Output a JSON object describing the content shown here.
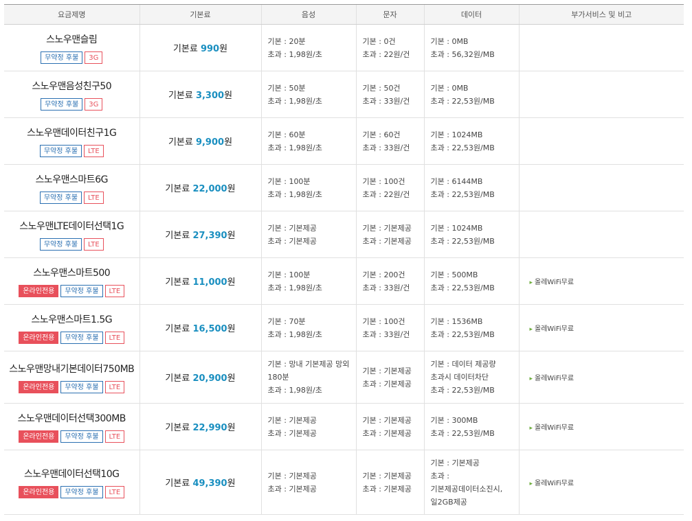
{
  "headers": [
    "요금제명",
    "기본료",
    "음성",
    "문자",
    "데이터",
    "부가서비스 및 비고"
  ],
  "fee_prefix": "기본료 ",
  "fee_suffix": "원",
  "badge_labels": {
    "contract": "무약정 후불",
    "online": "온라인전용"
  },
  "plans": [
    {
      "name": "스노우맨슬림",
      "badges": [
        "contract",
        "3G"
      ],
      "fee": "990",
      "voice": [
        "기본 : 20분",
        "초과 : 1,98원/초"
      ],
      "sms": [
        "기본 : 0건",
        "초과 : 22원/건"
      ],
      "data": [
        "기본 : 0MB",
        "초과 : 56,32원/MB"
      ],
      "extra": ""
    },
    {
      "name": "스노우맨음성친구50",
      "badges": [
        "contract",
        "3G"
      ],
      "fee": "3,300",
      "voice": [
        "기본 : 50분",
        "초과 : 1,98원/초"
      ],
      "sms": [
        "기본 : 50건",
        "초과 : 33원/건"
      ],
      "data": [
        "기본 : 0MB",
        "초과 : 22,53원/MB"
      ],
      "extra": ""
    },
    {
      "name": "스노우맨데이터친구1G",
      "badges": [
        "contract",
        "LTE"
      ],
      "fee": "9,900",
      "voice": [
        "기본 : 60분",
        "초과 : 1,98원/초"
      ],
      "sms": [
        "기본 : 60건",
        "초과 : 33원/건"
      ],
      "data": [
        "기본 : 1024MB",
        "초과 : 22,53원/MB"
      ],
      "extra": ""
    },
    {
      "name": "스노우맨스마트6G",
      "badges": [
        "contract",
        "LTE"
      ],
      "fee": "22,000",
      "voice": [
        "기본 : 100분",
        "초과 : 1,98원/초"
      ],
      "sms": [
        "기본 : 100건",
        "초과 : 22원/건"
      ],
      "data": [
        "기본 : 6144MB",
        "초과 : 22,53원/MB"
      ],
      "extra": ""
    },
    {
      "name": "스노우맨LTE데이터선택1G",
      "badges": [
        "contract",
        "LTE"
      ],
      "fee": "27,390",
      "voice": [
        "기본 : 기본제공",
        "초과 : 기본제공"
      ],
      "sms": [
        "기본 : 기본제공",
        "초과 : 기본제공"
      ],
      "data": [
        "기본 : 1024MB",
        "초과 : 22,53원/MB"
      ],
      "extra": ""
    },
    {
      "name": "스노우맨스마트500",
      "badges": [
        "online",
        "contract",
        "LTE"
      ],
      "fee": "11,000",
      "voice": [
        "기본 : 100분",
        "초과 : 1,98원/초"
      ],
      "sms": [
        "기본 : 200건",
        "초과 : 33원/건"
      ],
      "data": [
        "기본 : 500MB",
        "초과 : 22,53원/MB"
      ],
      "extra": "올레WiFi무료"
    },
    {
      "name": "스노우맨스마트1.5G",
      "badges": [
        "online",
        "contract",
        "LTE"
      ],
      "fee": "16,500",
      "voice": [
        "기본 : 70분",
        "초과 : 1,98원/초"
      ],
      "sms": [
        "기본 : 100건",
        "초과 : 33원/건"
      ],
      "data": [
        "기본 : 1536MB",
        "초과 : 22,53원/MB"
      ],
      "extra": "올레WiFi무료"
    },
    {
      "name": "스노우맨망내기본데이터750MB",
      "badges": [
        "online",
        "contract",
        "LTE"
      ],
      "fee": "20,900",
      "voice": [
        "기본 : 망내 기본제공 망외",
        "180분",
        "초과 : 1,98원/초"
      ],
      "sms": [
        "기본 : 기본제공",
        "초과 : 기본제공"
      ],
      "data": [
        "기본 : 데이터 제공량",
        "초과시 데이터차단",
        "초과 : 22,53원/MB"
      ],
      "extra": "올레WiFi무료"
    },
    {
      "name": "스노우맨데이터선택300MB",
      "badges": [
        "online",
        "contract",
        "LTE"
      ],
      "fee": "22,990",
      "voice": [
        "기본 : 기본제공",
        "초과 : 기본제공"
      ],
      "sms": [
        "기본 : 기본제공",
        "초과 : 기본제공"
      ],
      "data": [
        "기본 : 300MB",
        "초과 : 22,53원/MB"
      ],
      "extra": "올레WiFi무료"
    },
    {
      "name": "스노우맨데이터선택10G",
      "badges": [
        "online",
        "contract",
        "LTE"
      ],
      "fee": "49,390",
      "voice": [
        "기본 : 기본제공",
        "초과 : 기본제공"
      ],
      "sms": [
        "기본 : 기본제공",
        "초과 : 기본제공"
      ],
      "data": [
        "기본 : 기본제공",
        "초과 :",
        "기본제공데이터소진시,",
        "일2GB제공"
      ],
      "extra": "올레WiFi무료"
    }
  ],
  "colors": {
    "fee_amount": "#1a8fc0",
    "contract_badge": "#2a6fb1",
    "online_badge": "#e8505b",
    "net_badge": "#e8505b",
    "bullet": "#6fae3e"
  }
}
